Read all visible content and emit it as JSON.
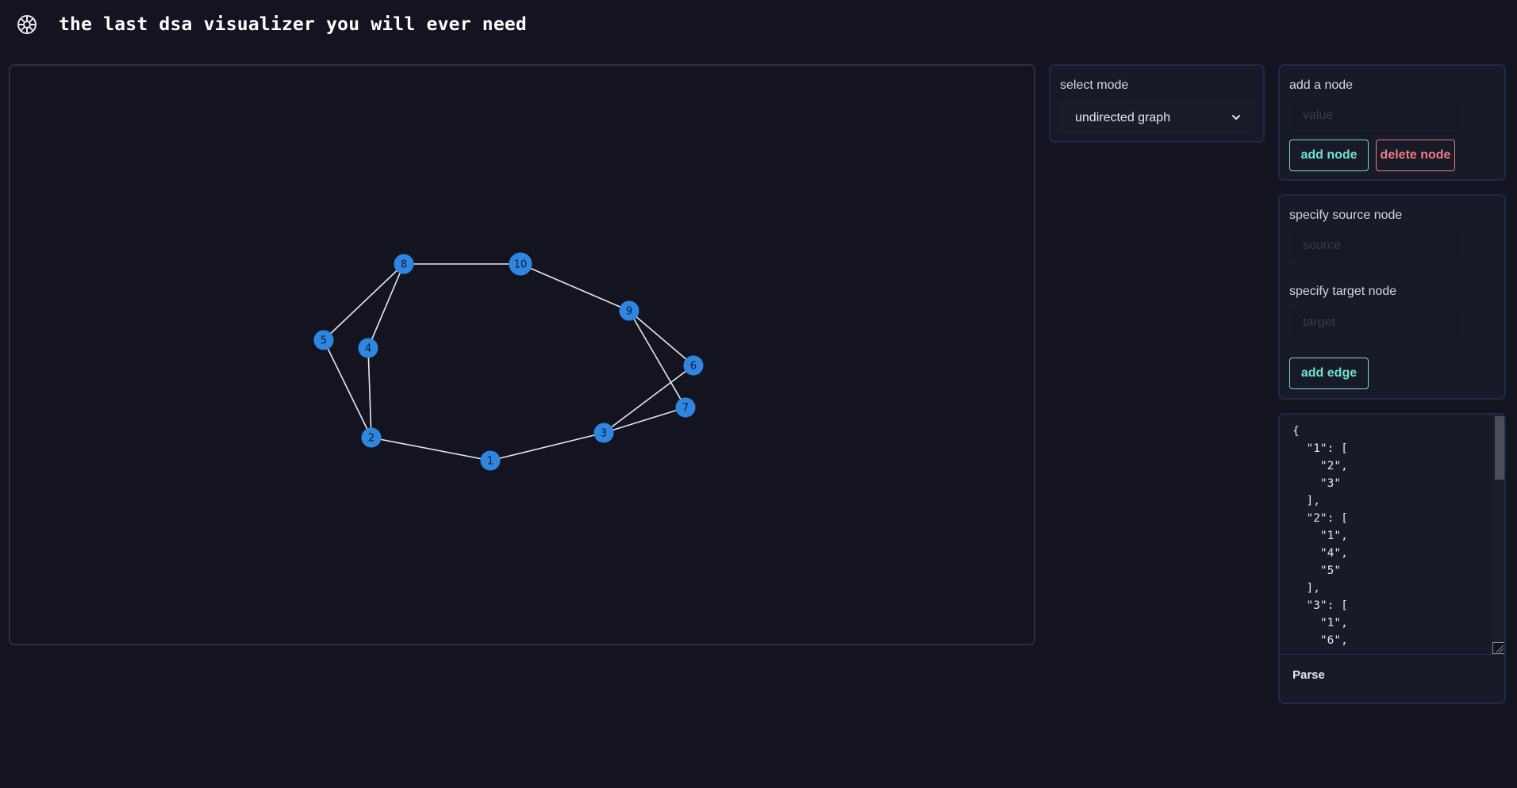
{
  "header": {
    "logo_icon": "steering-wheel-icon",
    "title": "the last dsa visualizer you will ever need"
  },
  "graph": {
    "nodes": [
      {
        "id": "1",
        "label": "1"
      },
      {
        "id": "2",
        "label": "2"
      },
      {
        "id": "3",
        "label": "3"
      },
      {
        "id": "4",
        "label": "4"
      },
      {
        "id": "5",
        "label": "5"
      },
      {
        "id": "6",
        "label": "6"
      },
      {
        "id": "7",
        "label": "7"
      },
      {
        "id": "8",
        "label": "8"
      },
      {
        "id": "9",
        "label": "9"
      },
      {
        "id": "10",
        "label": "10"
      }
    ],
    "edges": [
      [
        "1",
        "2"
      ],
      [
        "1",
        "3"
      ],
      [
        "2",
        "4"
      ],
      [
        "2",
        "5"
      ],
      [
        "3",
        "6"
      ],
      [
        "3",
        "7"
      ],
      [
        "4",
        "8"
      ],
      [
        "5",
        "8"
      ],
      [
        "8",
        "10"
      ],
      [
        "10",
        "9"
      ],
      [
        "9",
        "6"
      ],
      [
        "9",
        "7"
      ]
    ],
    "node_color": "#2f86e0",
    "edge_color": "#e8e8ee"
  },
  "mode": {
    "label": "select mode",
    "selected": "undirected graph",
    "chevron_icon": "chevron-down-icon"
  },
  "add_node": {
    "label": "add a node",
    "input_placeholder": "value",
    "add_button": "add node",
    "delete_button": "delete node"
  },
  "add_edge": {
    "source_label": "specify source node",
    "source_placeholder": "source",
    "target_label": "specify target node",
    "target_placeholder": "target",
    "add_button": "add edge"
  },
  "json_editor": {
    "content": "{\n  \"1\": [\n    \"2\",\n    \"3\"\n  ],\n  \"2\": [\n    \"1\",\n    \"4\",\n    \"5\"\n  ],\n  \"3\": [\n    \"1\",\n    \"6\",",
    "parse_button": "Parse"
  },
  "colors": {
    "background": "#13141f",
    "accent_teal": "#6fe0d2",
    "accent_red": "#ee7d7d",
    "panel_border": "#1f2a4b"
  }
}
